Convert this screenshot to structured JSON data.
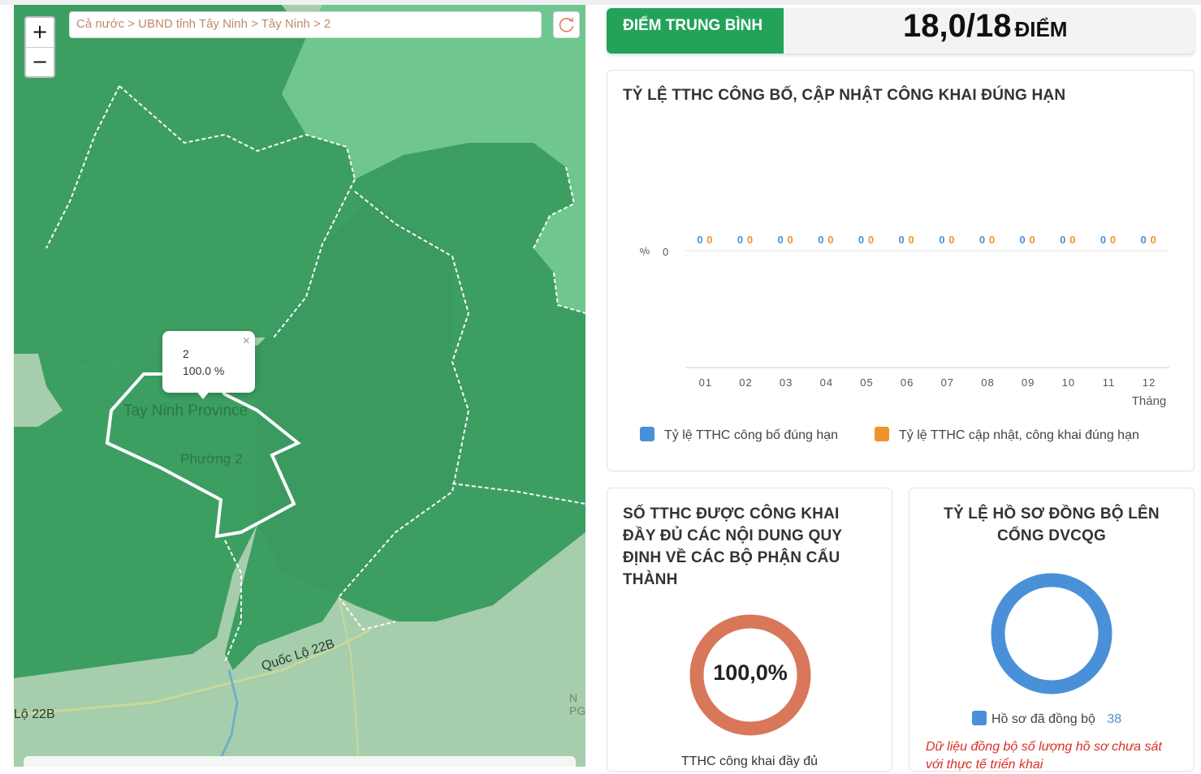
{
  "map": {
    "breadcrumb": "Cả nước > UBND tỉnh Tây Ninh > Tây Ninh > 2",
    "zoom_in": "+",
    "zoom_out": "−",
    "popup": {
      "name": "2",
      "value": "100.0 %",
      "close": "×"
    },
    "labels": {
      "road_a": "Quốc Lộ 22B",
      "road_b": "Lộ 22B",
      "place_main": "Tay Ninh Province",
      "place_ward": "Phường 2",
      "edge_letters": "N\nPG"
    },
    "colors": {
      "region_dark": "#3d9e62",
      "region_light": "#6fc68e",
      "base": "#a6ceac"
    }
  },
  "score": {
    "label": "ĐIỂM TRUNG BÌNH",
    "value": "18,0/18",
    "unit": "ĐIỂM",
    "color": "#23a35a"
  },
  "chart_card": {
    "title": "TỶ LỆ TTHC CÔNG BỐ, CẬP NHẬT CÔNG KHAI ĐÚNG HẠN",
    "y_unit_symbol": "%",
    "y_tick": "0",
    "x_axis_name": "Tháng"
  },
  "chart_data": {
    "type": "bar",
    "categories": [
      "01",
      "02",
      "03",
      "04",
      "05",
      "06",
      "07",
      "08",
      "09",
      "10",
      "11",
      "12"
    ],
    "series": [
      {
        "name": "Tỷ lệ TTHC công bố đúng hạn",
        "color": "#4a90d9",
        "values": [
          0,
          0,
          0,
          0,
          0,
          0,
          0,
          0,
          0,
          0,
          0,
          0
        ]
      },
      {
        "name": "Tỷ lệ TTHC cập nhật, công khai đúng hạn",
        "color": "#f0932b",
        "values": [
          0,
          0,
          0,
          0,
          0,
          0,
          0,
          0,
          0,
          0,
          0,
          0
        ]
      }
    ],
    "xlabel": "Tháng",
    "ylabel": "%",
    "ylim": [
      0,
      0
    ],
    "legend": "bottom"
  },
  "card_full": {
    "title_lines": [
      "SỐ TTHC ĐƯỢC CÔNG KHAI",
      "ĐẦY ĐỦ CÁC NỘI DUNG QUY",
      "ĐỊNH VỀ CÁC BỘ PHẬN CẤU",
      "THÀNH"
    ],
    "percent": "100,0%",
    "caption": "TTHC công khai đầy đủ",
    "ring_color": "#d8775a",
    "ring_fraction": 1.0
  },
  "card_sync": {
    "title_lines": [
      "TỶ LỆ HỒ SƠ ĐỒNG BỘ LÊN",
      "CỔNG DVCQG"
    ],
    "legend_label": "Hồ sơ đã đồng bộ",
    "legend_count": "38",
    "ring_color": "#4a90d9",
    "note_lines": [
      "Dữ liệu đồng bộ số lượng hồ sơ chưa sát",
      "với thực tế triển khai"
    ]
  }
}
